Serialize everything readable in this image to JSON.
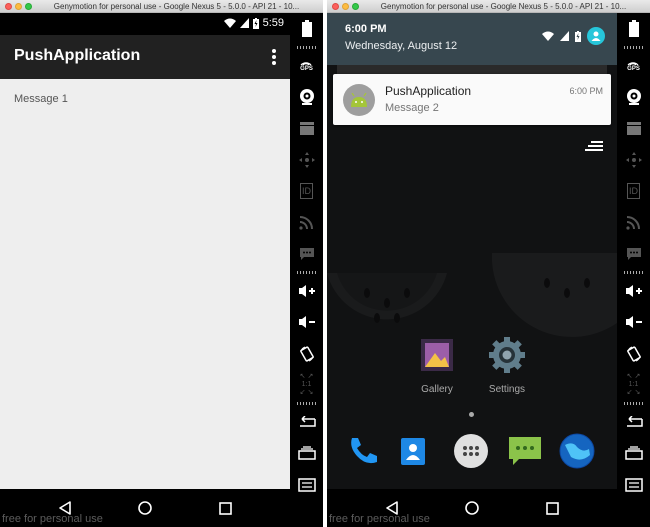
{
  "window_title": "Genymotion for personal use - Google Nexus 5 - 5.0.0 - API 21 - 10...",
  "left": {
    "status_time": "5:59",
    "app_title": "PushApplication",
    "message": "Message 1",
    "watermark": "free for personal use"
  },
  "right": {
    "shade_time": "6:00 PM",
    "shade_date": "Wednesday, August 12",
    "notification": {
      "title": "PushApplication",
      "text": "Message 2",
      "time": "6:00 PM"
    },
    "home_icons": [
      {
        "label": "Gallery"
      },
      {
        "label": "Settings"
      }
    ],
    "watermark": "free for personal use"
  },
  "sidebar_labels": {
    "gps": "GPS",
    "id": "ID",
    "zoom": "1:1"
  },
  "sidebar_icons": [
    "battery-icon",
    "gps-icon",
    "webcam-icon",
    "clapper-icon",
    "dpad-icon",
    "id-icon",
    "rss-icon",
    "sms-icon",
    "volume-up-icon",
    "volume-down-icon",
    "rotate-icon",
    "zoom-icon",
    "back-icon",
    "recents-icon",
    "menu-icon"
  ],
  "colors": {
    "appbar": "#212121",
    "content_bg": "#eeeeee",
    "shade": "#37474f",
    "avatar": "#26c6da"
  }
}
